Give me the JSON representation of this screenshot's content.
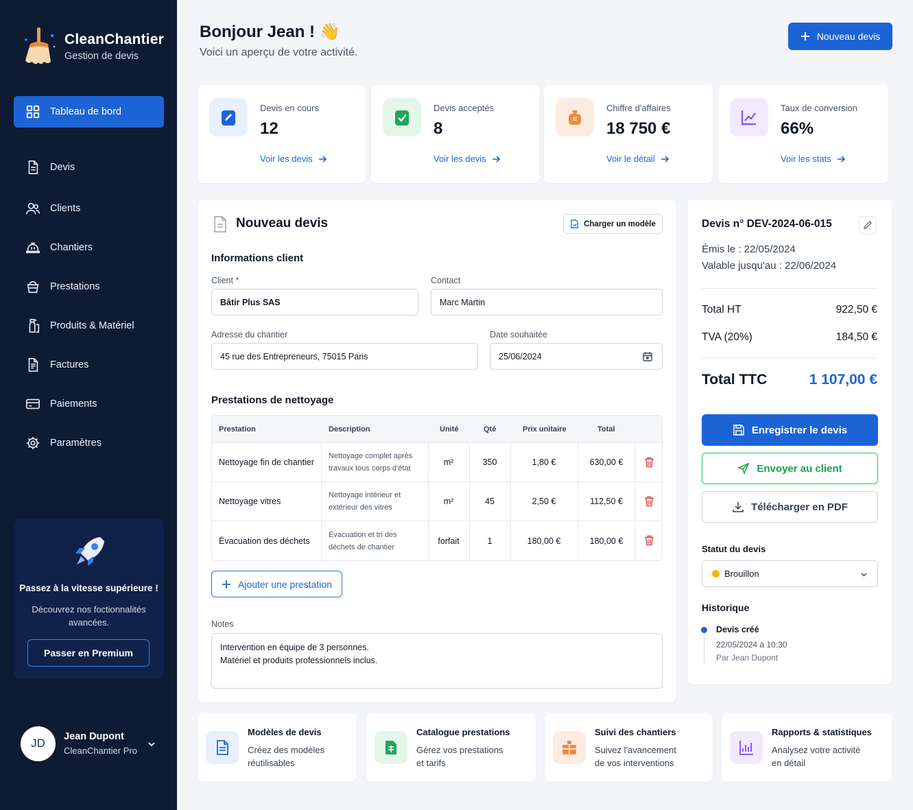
{
  "sidebar": {
    "brand_name": "CleanChantier",
    "brand_sub": "Gestion de devis",
    "active_item": "Tableau de bord",
    "items": [
      "Devis",
      "Clients",
      "Chantiers",
      "Prestations",
      "Produits & Matériel",
      "Factures",
      "Paiements",
      "Paramètres"
    ],
    "promo": {
      "title": "Passez à la vitesse supérieure !",
      "text": "Découvrez nos foctionnalités avancées.",
      "button": "Passer en Premium"
    },
    "user": {
      "initials": "JD",
      "name": "Jean Dupont",
      "plan": "CleanChantier Pro"
    }
  },
  "header": {
    "greeting": "Bonjour Jean ! 👋",
    "subtitle": "Voici un aperçu de votre activité.",
    "new_button": "Nouveau devis"
  },
  "stats": [
    {
      "label": "Devis en cours",
      "value": "12",
      "link": "Voir les devis"
    },
    {
      "label": "Devis acceptés",
      "value": "8",
      "link": "Voir les devis"
    },
    {
      "label": "Chiffre d'affaires",
      "value": "18 750 €",
      "link": "Voir le détail"
    },
    {
      "label": "Taux de conversion",
      "value": "66%",
      "link": "Voir les stats"
    }
  ],
  "form": {
    "title": "Nouveau devis",
    "load_model": "Charger un modèle",
    "client_section": "Informations client",
    "client_label": "Client",
    "required_mark": "*",
    "client_value": "Bâtir Plus SAS",
    "contact_label": "Contact",
    "contact_value": "Marc Martin",
    "address_label": "Adresse du chantier",
    "address_value": "45 rue des Entrepreneurs, 75015 Paris",
    "date_label": "Date souhaitée",
    "date_value": "25/06/2024",
    "services_section": "Prestations de nettoyage",
    "columns": [
      "Prestation",
      "Description",
      "Unité",
      "Qté",
      "Prix unitaire",
      "Total"
    ],
    "rows": [
      {
        "name": "Nettoyage fin de chantier",
        "desc1": "Nettoyage complet après",
        "desc2": "travaux tous corps d'état",
        "unit": "m²",
        "qty": "350",
        "price": "1,80 €",
        "total": "630,00 €"
      },
      {
        "name": "Nettoyage vitres",
        "desc1": "Nettoyage intérieur et",
        "desc2": "extérieur des vitres",
        "unit": "m²",
        "qty": "45",
        "price": "2,50 €",
        "total": "112,50 €"
      },
      {
        "name": "Évacuation des déchets",
        "desc1": "Évacuation et tri des",
        "desc2": "déchets de chantier",
        "unit": "forfait",
        "qty": "1",
        "price": "180,00 €",
        "total": "180,00 €"
      }
    ],
    "add_button": "Ajouter une prestation",
    "notes_label": "Notes",
    "notes_line1": "Intervention en équipe de 3 personnes.",
    "notes_line2": "Matériel et produits professionnels inclus."
  },
  "summary": {
    "title": "Devis n° DEV-2024-06-015",
    "issued": "Émis le : 22/05/2024",
    "valid": "Valable jusqu'au : 22/06/2024",
    "ht_label": "Total HT",
    "ht_value": "922,50 €",
    "tva_label": "TVA (20%)",
    "tva_value": "184,50 €",
    "ttc_label": "Total TTC",
    "ttc_value": "1 107,00 €",
    "save_button": "Enregistrer le devis",
    "send_button": "Envoyer au client",
    "pdf_button": "Télécharger en PDF",
    "status_label": "Statut du devis",
    "status_value": "Brouillon",
    "history_label": "Historique",
    "history_event": "Devis créé",
    "history_date": "22/05/2024 à 10:30",
    "history_by": "Par Jean Dupont"
  },
  "features": [
    {
      "title": "Modèles de devis",
      "line1": "Créez des modèles",
      "line2": "réutilisables"
    },
    {
      "title": "Catalogue prestations",
      "line1": "Gérez vos prestations",
      "line2": "et tarifs"
    },
    {
      "title": "Suivi des chantiers",
      "line1": "Suivez l'avancement",
      "line2": "de vos interventions"
    },
    {
      "title": "Rapports & statistiques",
      "line1": "Analysez votre activité",
      "line2": "en détail"
    }
  ],
  "colors": {
    "accent": "#1c64d6",
    "sidebar": "#0d1b33",
    "success": "#16a34a",
    "danger": "#dc2626",
    "status_draft": "#f5b90b"
  }
}
